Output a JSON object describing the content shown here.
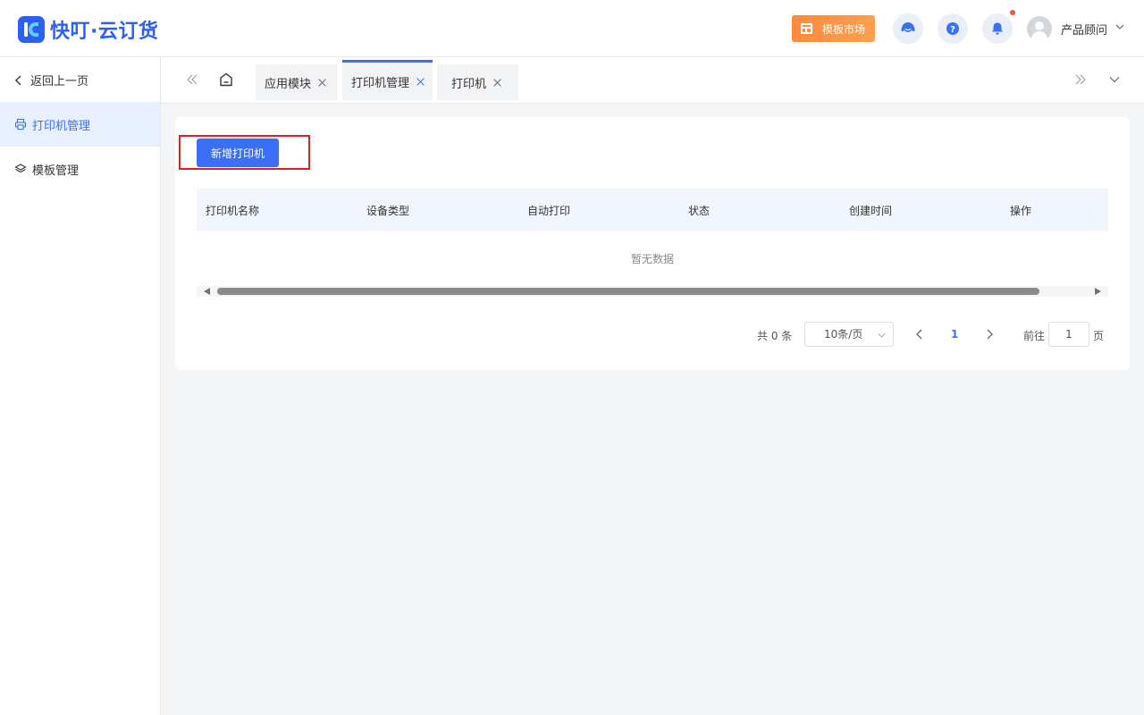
{
  "app": {
    "logo_text": "快叮·云订货"
  },
  "header": {
    "market_label": "模板市场",
    "user_name": "产品顾问",
    "icons": [
      "customer-service-icon",
      "help-icon",
      "bell-icon",
      "avatar",
      "chevron-down-icon"
    ]
  },
  "sidebar": {
    "back_label": "返回上一页",
    "items": [
      {
        "label": "打印机管理",
        "icon": "printer-icon",
        "active": true
      },
      {
        "label": "模板管理",
        "icon": "layers-icon",
        "active": false
      }
    ]
  },
  "tabs": [
    {
      "label": "应用模块",
      "active": false
    },
    {
      "label": "打印机管理",
      "active": true
    },
    {
      "label": "打印机",
      "active": false
    }
  ],
  "main": {
    "add_button": "新增打印机",
    "table": {
      "columns": [
        "打印机名称",
        "设备类型",
        "自动打印",
        "状态",
        "创建时间",
        "操作"
      ],
      "empty_text": "暂无数据"
    },
    "pagination": {
      "total": "共 0 条",
      "page_size": "10条/页",
      "current_page": "1",
      "goto_label": "前往",
      "goto_value": "1",
      "page_unit": "页"
    }
  },
  "colors": {
    "primary": "#3a6ff7",
    "brand": "#2b5ff5",
    "market_orange": "#ff8a3d",
    "highlight_red": "#e02020"
  }
}
